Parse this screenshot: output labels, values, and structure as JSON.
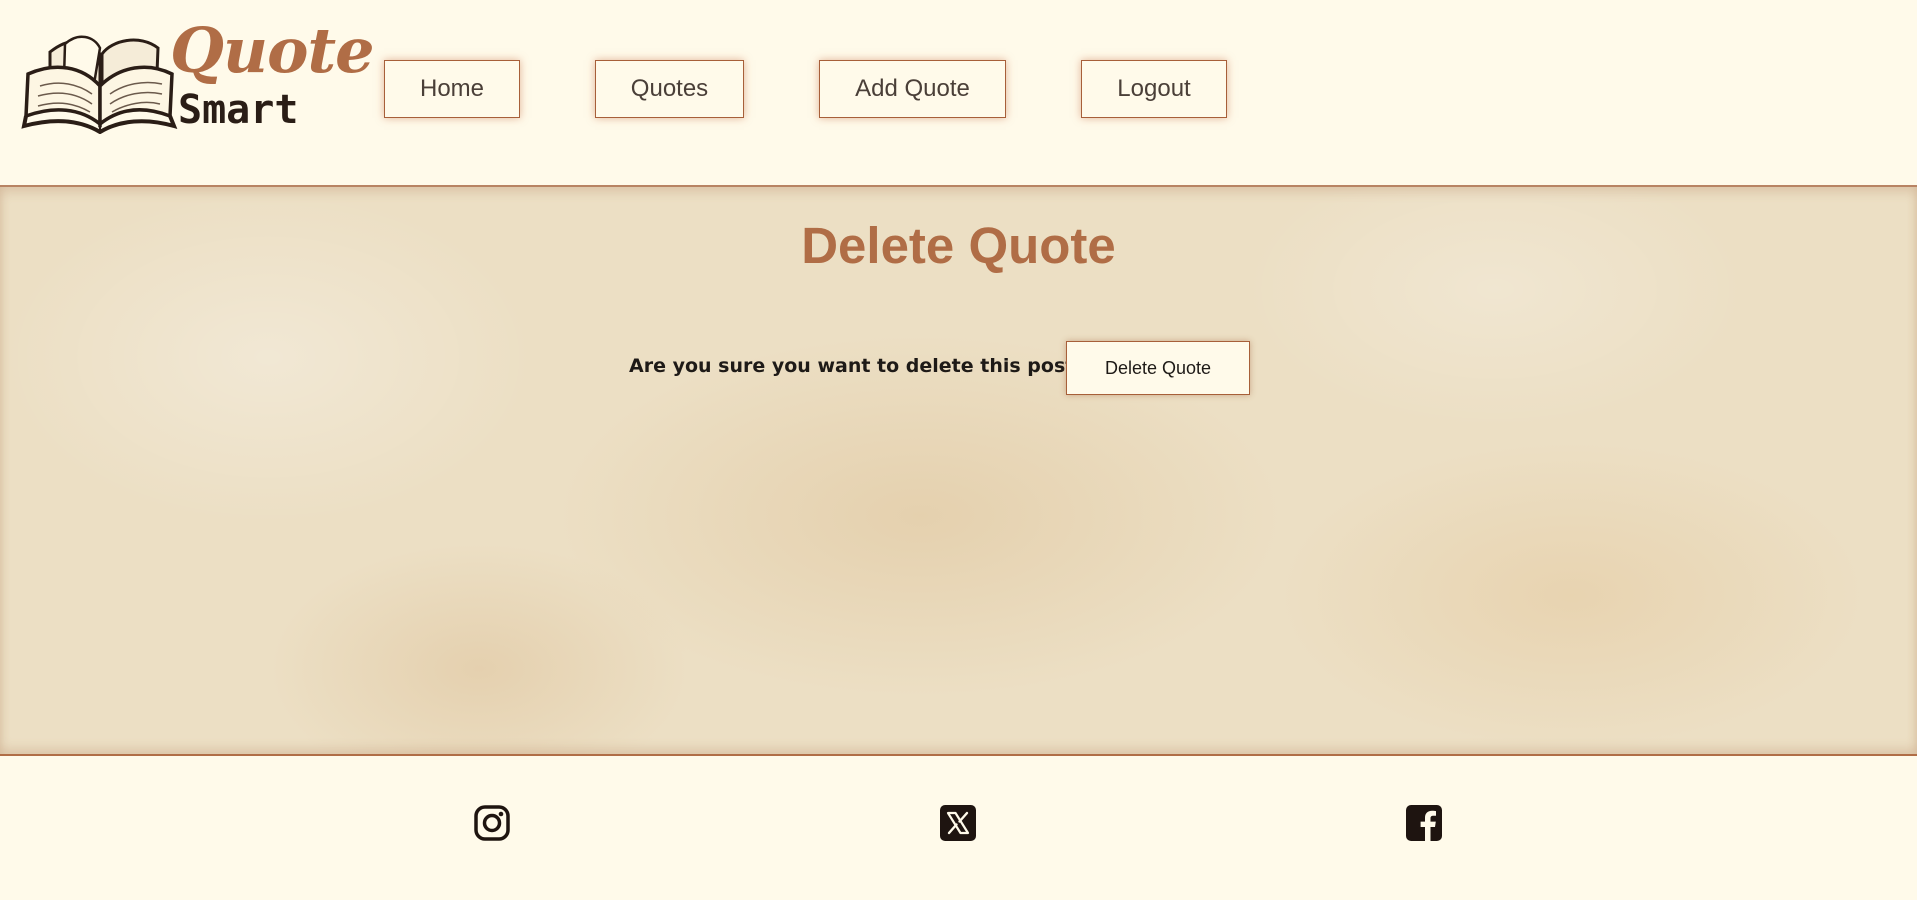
{
  "brand": {
    "logo_word_top": "Quote",
    "logo_word_bottom": "Smart",
    "accent_color": "#b06d46",
    "dark_color": "#2a1d16"
  },
  "nav": {
    "items": [
      {
        "label": "Home"
      },
      {
        "label": "Quotes"
      },
      {
        "label": "Add Quote"
      },
      {
        "label": "Logout"
      }
    ]
  },
  "main": {
    "title": "Delete Quote",
    "confirm_prompt": "Are you sure you want to delete this post?",
    "delete_button_label": "Delete Quote"
  },
  "footer": {
    "social_links": [
      {
        "icon": "instagram-icon"
      },
      {
        "icon": "x-twitter-icon"
      },
      {
        "icon": "facebook-icon"
      }
    ]
  }
}
